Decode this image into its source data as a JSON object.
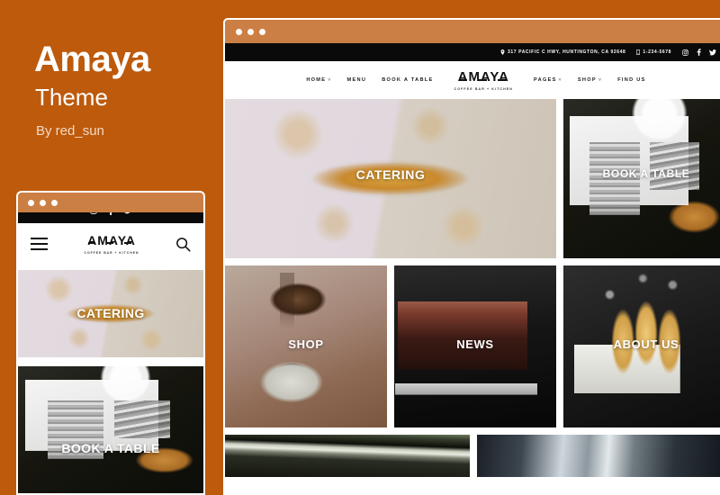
{
  "promo": {
    "title": "Amaya",
    "subtitle": "Theme",
    "author": "By red_sun"
  },
  "colors": {
    "background": "#bd5a0c",
    "chrome": "#cc7f44",
    "topbar": "#0a0a0a",
    "text_on_dark": "#ffffff"
  },
  "site": {
    "topbar": {
      "address": "317 PACIFIC C HWY, HUNTINGTON, CA 92648",
      "phone": "1-234-5678",
      "socials": [
        "instagram-icon",
        "facebook-icon",
        "twitter-icon"
      ]
    },
    "logo": {
      "word": "AMAYA",
      "tagline": "COFFEE BAR + KITCHEN"
    },
    "nav": {
      "left": [
        {
          "label": "HOME",
          "has_dropdown": true
        },
        {
          "label": "MENU",
          "has_dropdown": false
        },
        {
          "label": "BOOK A TABLE",
          "has_dropdown": false
        }
      ],
      "right": [
        {
          "label": "PAGES",
          "has_dropdown": true
        },
        {
          "label": "SHOP",
          "has_dropdown": true
        },
        {
          "label": "FIND US",
          "has_dropdown": false
        }
      ],
      "caret": "˅"
    },
    "tiles": [
      {
        "label": "CATERING",
        "photo": "sliced-bread-on-marble"
      },
      {
        "label": "BOOK A TABLE",
        "photo": "open-book-with-coffee-cup"
      },
      {
        "label": "SHOP",
        "photo": "pouring-coffee-into-cup"
      },
      {
        "label": "NEWS",
        "photo": "chocolate-brownie-slice"
      },
      {
        "label": "ABOUT US",
        "photo": "churros-in-newspaper"
      },
      {
        "label": "",
        "photo": "cafe-counter-blurred"
      },
      {
        "label": "",
        "photo": "espresso-portafilter"
      }
    ]
  },
  "mobile": {
    "search_icon": "search-icon",
    "menu_icon": "hamburger-menu-icon",
    "tiles": [
      {
        "label": "CATERING",
        "photo": "sliced-bread-on-marble"
      },
      {
        "label": "BOOK A TABLE",
        "photo": "open-book-with-coffee-cup"
      }
    ]
  }
}
